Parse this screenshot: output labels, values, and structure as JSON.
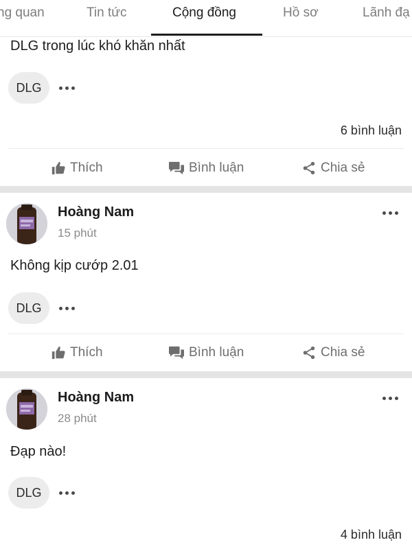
{
  "tabs": [
    {
      "label": "ng quan"
    },
    {
      "label": "Tin tức"
    },
    {
      "label": "Cộng đồng"
    },
    {
      "label": "Hồ sơ"
    },
    {
      "label": "Lãnh đạ"
    }
  ],
  "active_tab": "Cộng đồng",
  "posts": [
    {
      "content": "DLG trong  lúc khó khăn nhất",
      "tag": "DLG",
      "comments": "6 bình luận",
      "actions": {
        "like": "Thích",
        "comment": "Bình luận",
        "share": "Chia sẻ"
      }
    },
    {
      "author": "Hoàng Nam",
      "time": "15 phút",
      "content": "Không kịp cướp 2.01",
      "tag": "DLG",
      "actions": {
        "like": "Thích",
        "comment": "Bình luận",
        "share": "Chia sẻ"
      }
    },
    {
      "author": "Hoàng Nam",
      "time": "28 phút",
      "content": "Đạp nào!",
      "tag": "DLG",
      "comments": "4 bình luận"
    }
  ],
  "icons": {
    "like": "thumbs-up-icon",
    "comment": "chat-bubbles-icon",
    "share": "share-icon",
    "more": "ellipsis-icon"
  },
  "colors": {
    "active_tab": "#1c1c1e",
    "inactive_tab": "#7d7d7d",
    "action_text": "#6e6e6e",
    "separator": "#e4e4e4",
    "chip_bg": "#ececec"
  }
}
